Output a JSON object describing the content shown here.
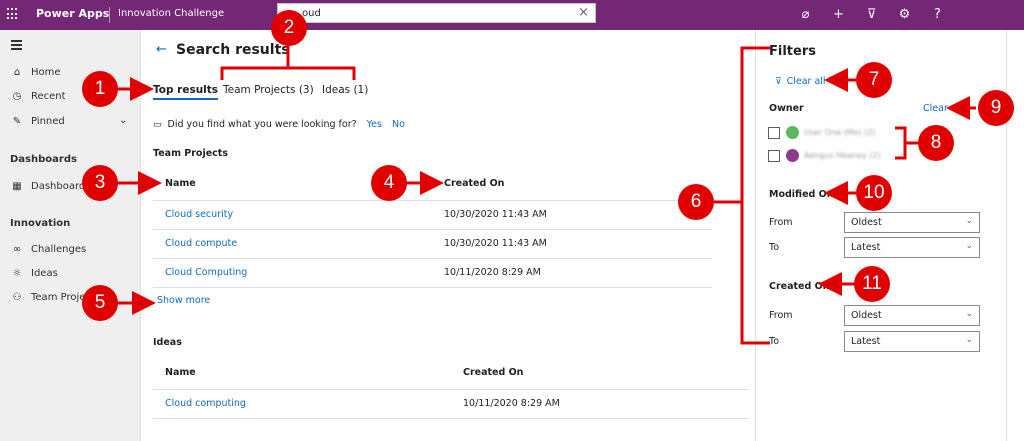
{
  "topbar": {
    "brand": "Power Apps",
    "app_name": "Innovation Challenge",
    "search_value": "oud",
    "icons": [
      "target-icon",
      "plus-icon",
      "filter-icon",
      "gear-icon",
      "help-icon"
    ],
    "icon_glyphs": [
      "⌀",
      "+",
      "⊽",
      "⚙",
      "?"
    ]
  },
  "sidebar": {
    "items_top": [
      {
        "label": "Home",
        "icon": "home-icon",
        "glyph": "⌂"
      },
      {
        "label": "Recent",
        "icon": "clock-icon",
        "glyph": "◷"
      },
      {
        "label": "Pinned",
        "icon": "pin-icon",
        "glyph": "✎"
      }
    ],
    "dashboards_header": "Dashboards",
    "dashboards_item": {
      "label": "Dashboards",
      "icon": "dashboard-icon",
      "glyph": "▦"
    },
    "innovation_header": "Innovation",
    "innovation_items": [
      {
        "label": "Challenges",
        "icon": "binoculars-icon",
        "glyph": "∞"
      },
      {
        "label": "Ideas",
        "icon": "lightbulb-icon",
        "glyph": "☼"
      },
      {
        "label": "Team Proje",
        "icon": "team-icon",
        "glyph": "⚇"
      }
    ]
  },
  "main": {
    "title": "Search results",
    "tabs": [
      "Top results",
      "Team Projects (3)",
      "Ideas (1)"
    ],
    "feedback_question": "Did you find what you were looking for?",
    "feedback_yes": "Yes",
    "feedback_no": "No",
    "team_projects": {
      "section_title": "Team Projects",
      "columns": [
        "Name",
        "Created On"
      ],
      "rows": [
        {
          "name": "Cloud security",
          "created": "10/30/2020 11:43 AM"
        },
        {
          "name": "Cloud compute",
          "created": "10/30/2020 11:43 AM"
        },
        {
          "name": "Cloud Computing",
          "created": "10/11/2020 8:29 AM"
        }
      ],
      "show_more": "Show more"
    },
    "ideas": {
      "section_title": "Ideas",
      "columns": [
        "Name",
        "Created On"
      ],
      "rows": [
        {
          "name": "Cloud computing",
          "created": "10/11/2020 8:29 AM"
        }
      ]
    }
  },
  "filters": {
    "title": "Filters",
    "clear_all": "Clear all",
    "owner_label": "Owner",
    "owner_clear": "Clear",
    "owners": [
      {
        "name": "User One (Me) (2)",
        "color": "#5cb85c"
      },
      {
        "name": "Aengus Heaney (2)",
        "color": "#8e3b8e"
      }
    ],
    "modified_on_label": "Modified On",
    "created_on_label": "Created On",
    "from_label": "From",
    "to_label": "To",
    "modified_from": "Oldest",
    "modified_to": "Latest",
    "created_from": "Oldest",
    "created_to": "Latest"
  },
  "annotations": [
    "1",
    "2",
    "3",
    "4",
    "5",
    "6",
    "7",
    "8",
    "9",
    "10",
    "11"
  ],
  "colors": {
    "brand": "#742774",
    "link": "#0f6cbd",
    "annotation": "#e00000"
  }
}
